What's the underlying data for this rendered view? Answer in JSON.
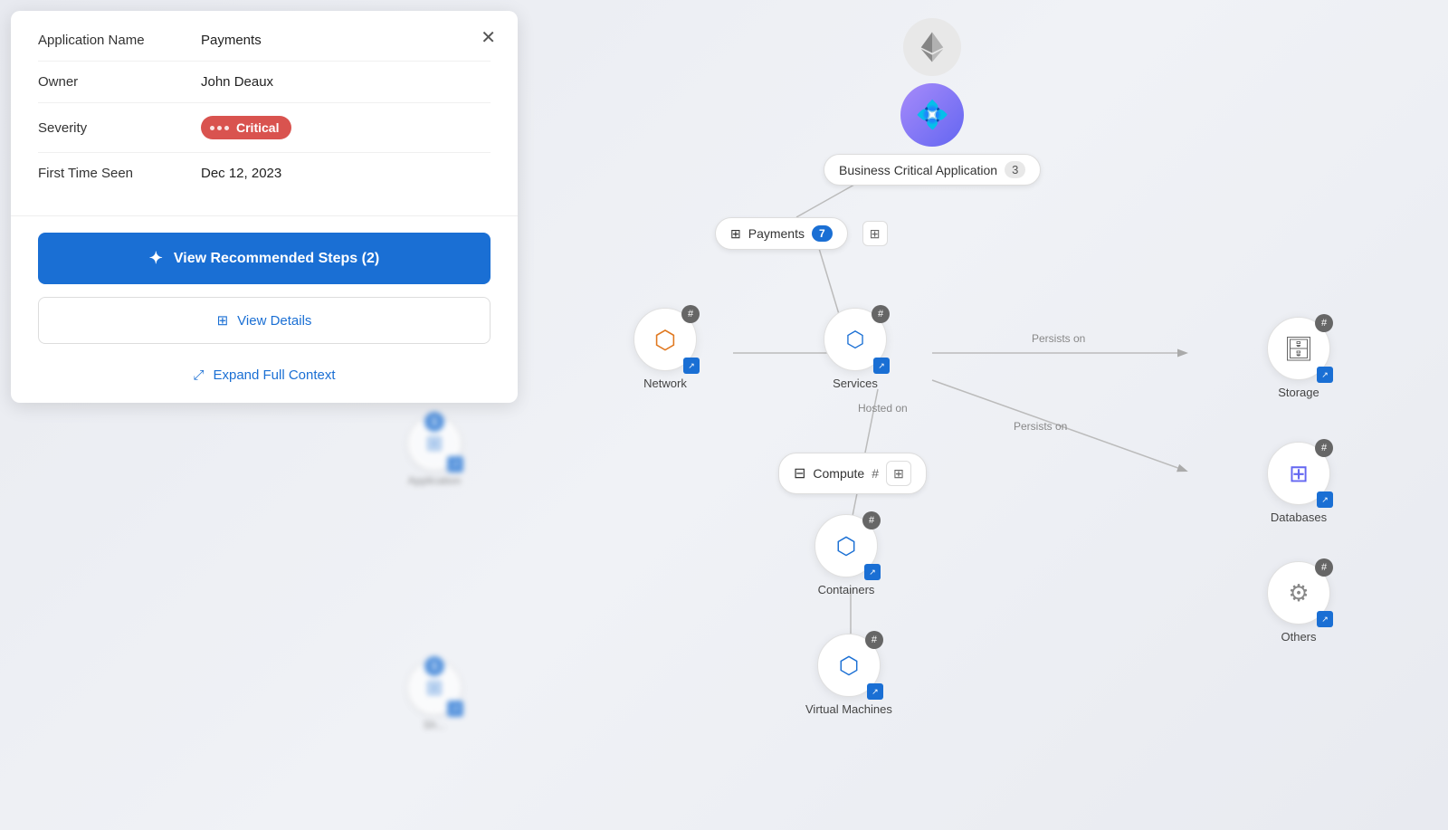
{
  "panel": {
    "title_label": "Application Name",
    "title_value": "Payments",
    "owner_label": "Owner",
    "owner_value": "John Deaux",
    "severity_label": "Severity",
    "severity_value": "Critical",
    "first_seen_label": "First Time Seen",
    "first_seen_value": "Dec 12, 2023",
    "btn_recommended": "View Recommended Steps (2)",
    "btn_details": "View Details",
    "btn_expand": "Expand Full Context"
  },
  "graph": {
    "bca_label": "Business Critical Application",
    "bca_count": "3",
    "payments_label": "Payments",
    "payments_count": "7",
    "nodes": [
      {
        "id": "network",
        "label": "Network",
        "icon": "🔗"
      },
      {
        "id": "services",
        "label": "Services",
        "icon": "⬡"
      },
      {
        "id": "containers",
        "label": "Containers",
        "icon": "🔲"
      },
      {
        "id": "virtual_machines",
        "label": "Virtual Machines",
        "icon": "🖥"
      }
    ],
    "right_nodes": [
      {
        "id": "storage",
        "label": "Storage",
        "icon": "🗄"
      },
      {
        "id": "databases",
        "label": "Databases",
        "icon": "📊"
      },
      {
        "id": "others",
        "label": "Others",
        "icon": "⚙"
      }
    ],
    "pill_nodes": [
      {
        "id": "compute",
        "label": "Compute",
        "hash": "#"
      }
    ],
    "connections": [
      {
        "from": "services",
        "to": "storage",
        "label": "Persists on"
      },
      {
        "from": "services",
        "to": "databases",
        "label": "Persists on"
      }
    ],
    "app_nodes": [
      {
        "id": "app1",
        "label": "Application",
        "badge": "1"
      },
      {
        "id": "app2",
        "label": "Sh...",
        "badge": "1"
      }
    ]
  },
  "icons": {
    "close": "✕",
    "star": "✦",
    "view_details_icon": "⊞",
    "expand_icon": "⤢",
    "hash": "#",
    "grid": "⊞"
  }
}
